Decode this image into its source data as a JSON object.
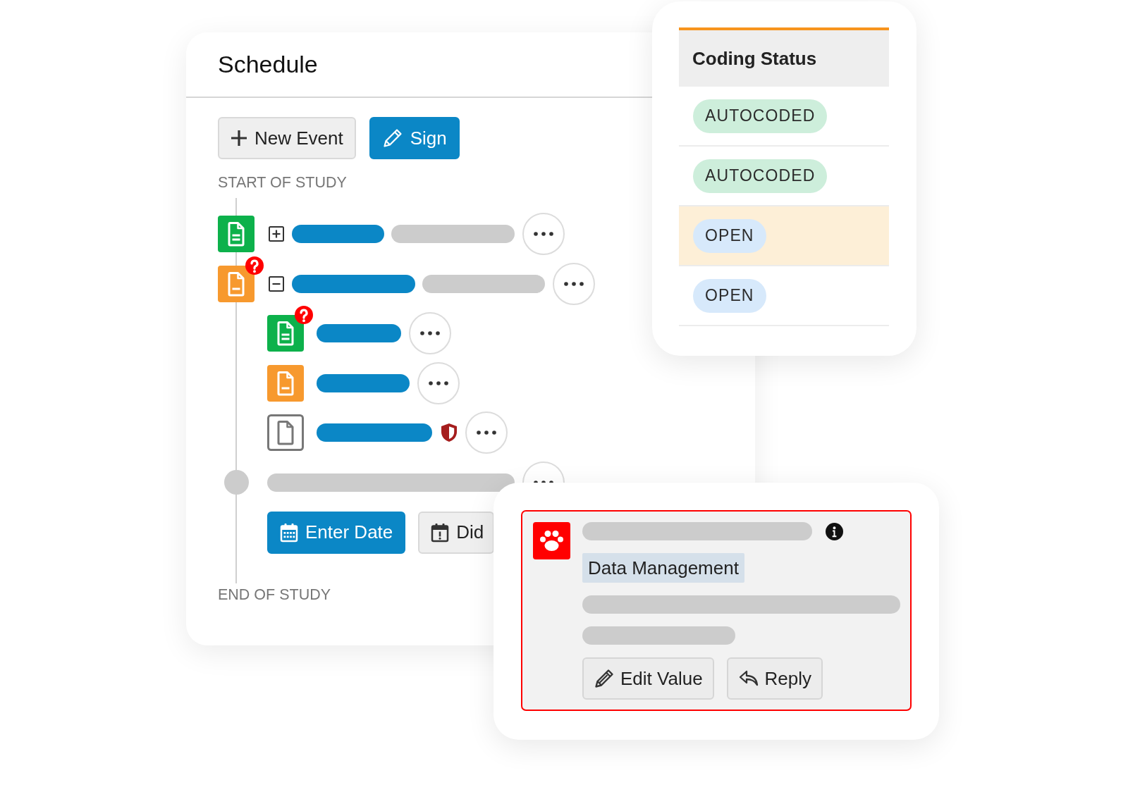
{
  "schedule": {
    "title": "Schedule",
    "toolbar": [
      {
        "kind": "add",
        "label": "New Event"
      },
      {
        "kind": "sign",
        "label": "Sign"
      }
    ],
    "start_label": "START OF STUDY",
    "events": [
      {
        "kind": "complete",
        "query": false,
        "expanded": false,
        "protected": false
      },
      {
        "kind": "partial",
        "query": true,
        "expanded": true,
        "protected": false,
        "children": [
          {
            "kind": "complete",
            "query": true,
            "protected": false
          },
          {
            "kind": "partial",
            "query": false,
            "protected": false
          },
          {
            "kind": "blank",
            "query": false,
            "protected": true
          }
        ]
      },
      {
        "kind": "milestone",
        "actions": [
          {
            "kind": "date",
            "label": "Enter Date"
          },
          {
            "kind": "missed",
            "label": "Did"
          }
        ]
      }
    ],
    "end_label": "END OF STUDY"
  },
  "coding": {
    "title": "Coding Status",
    "rows": [
      {
        "status": "AUTOCODED",
        "kind": "autocoded",
        "selected": false
      },
      {
        "status": "AUTOCODED",
        "kind": "autocoded",
        "selected": false
      },
      {
        "status": "OPEN",
        "kind": "open",
        "selected": true
      },
      {
        "status": "OPEN",
        "kind": "open",
        "selected": false
      }
    ]
  },
  "comment": {
    "tag": "Data Management",
    "actions": [
      {
        "kind": "edit",
        "label": "Edit Value"
      },
      {
        "kind": "reply",
        "label": "Reply"
      }
    ]
  }
}
